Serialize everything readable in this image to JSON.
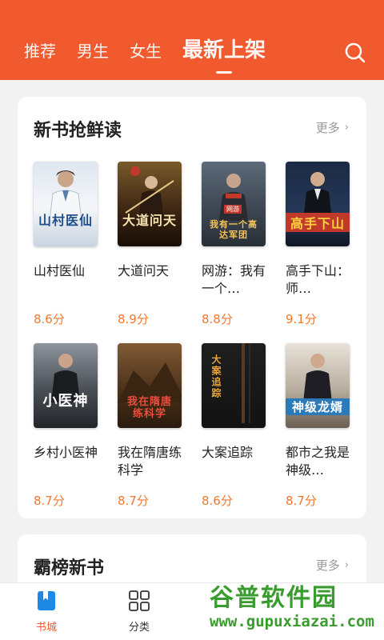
{
  "header": {
    "tabs": [
      {
        "label": "推荐"
      },
      {
        "label": "男生"
      },
      {
        "label": "女生"
      },
      {
        "label": "最新上架"
      }
    ],
    "active_tab": 3,
    "search_icon": "search-icon"
  },
  "section1": {
    "title": "新书抢鲜读",
    "more_label": "更多",
    "books": [
      {
        "name": "山村医仙",
        "score": "8.6分",
        "cover_text": "山村医仙",
        "cover_sub": ""
      },
      {
        "name": "大道问天",
        "score": "8.9分",
        "cover_text": "大道问天",
        "cover_sub": ""
      },
      {
        "name": "网游：我有一个…",
        "score": "8.8分",
        "cover_text": "我有一个高达军团",
        "cover_sub": "网游"
      },
      {
        "name": "高手下山：师…",
        "score": "9.1分",
        "cover_text": "高手下山",
        "cover_sub": ""
      },
      {
        "name": "乡村小医神",
        "score": "8.7分",
        "cover_text": "小医神",
        "cover_sub": ""
      },
      {
        "name": "我在隋唐练科学",
        "score": "8.7分",
        "cover_text": "我在隋唐练科学",
        "cover_sub": ""
      },
      {
        "name": "大案追踪",
        "score": "8.6分",
        "cover_text": "大案追踪",
        "cover_sub": ""
      },
      {
        "name": "都市之我是神级…",
        "score": "8.7分",
        "cover_text": "神级龙婿",
        "cover_sub": ""
      }
    ]
  },
  "section2": {
    "title": "霸榜新书",
    "more_label": "更多"
  },
  "bottom_nav": [
    {
      "label": "书城",
      "icon": "bookmark-book-icon"
    },
    {
      "label": "分类",
      "icon": "grid-icon"
    }
  ],
  "watermark": {
    "top": "谷普软件园",
    "bottom": "www.gupuxiazai.com"
  },
  "colors": {
    "brand": "#f15a2e",
    "score": "#f0782e"
  }
}
